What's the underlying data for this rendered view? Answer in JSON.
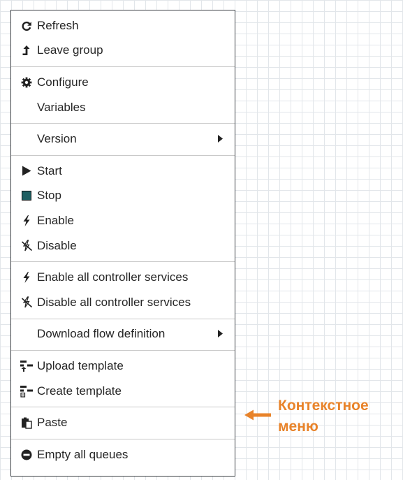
{
  "menu": {
    "items": {
      "refresh": "Refresh",
      "leave_group": "Leave group",
      "configure": "Configure",
      "variables": "Variables",
      "version": "Version",
      "start": "Start",
      "stop": "Stop",
      "enable": "Enable",
      "disable": "Disable",
      "enable_all": "Enable all controller services",
      "disable_all": "Disable all controller services",
      "download_flow": "Download flow definition",
      "upload_template": "Upload template",
      "create_template": "Create template",
      "paste": "Paste",
      "empty_queues": "Empty all queues"
    },
    "icons": {
      "refresh": "refresh-icon",
      "leave_group": "leave-group-icon",
      "configure": "gear-icon",
      "start": "play-icon",
      "stop": "stop-icon",
      "enable": "lightning-bolt-icon",
      "disable": "disabled-bolt-icon",
      "upload_template": "upload-template-icon",
      "create_template": "create-template-icon",
      "paste": "paste-icon",
      "empty_queues": "minus-circle-icon",
      "submenu": "submenu-arrow-icon"
    }
  },
  "annotation": {
    "text": "Контекстное\nменю",
    "color": "#e8832a"
  },
  "colors": {
    "border": "#3a3f44",
    "separator": "#c9c9c9",
    "text": "#262626",
    "stop_icon": "#1f5f62",
    "grid": "#e2e6ea"
  }
}
